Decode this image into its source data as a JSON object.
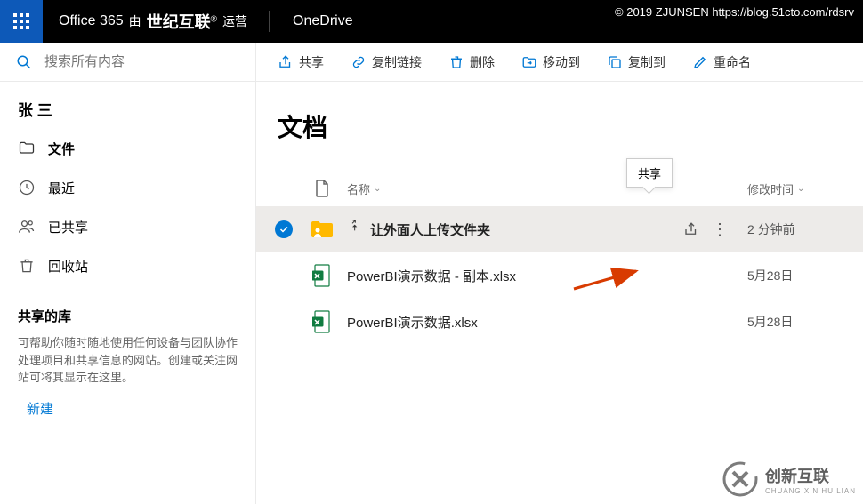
{
  "watermark": "© 2019 ZJUNSEN https://blog.51cto.com/rdsrv",
  "header": {
    "o365": "Office 365",
    "by": "由",
    "company": "世纪互联",
    "suffix": "运营",
    "app": "OneDrive"
  },
  "search": {
    "placeholder": "搜索所有内容"
  },
  "user": "张 三",
  "nav": {
    "files": "文件",
    "recent": "最近",
    "shared": "已共享",
    "recycle": "回收站"
  },
  "libs": {
    "title": "共享的库",
    "desc": "可帮助你随时随地使用任何设备与团队协作处理项目和共享信息的网站。创建或关注网站可将其显示在这里。",
    "new": "新建"
  },
  "cmd": {
    "share": "共享",
    "copylink": "复制链接",
    "delete": "删除",
    "moveto": "移动到",
    "copyto": "复制到",
    "rename": "重命名"
  },
  "page": {
    "title": "文档"
  },
  "cols": {
    "name": "名称",
    "modtime": "修改时间"
  },
  "tooltip": "共享",
  "rows": [
    {
      "name": "让外面人上传文件夹",
      "modified": "2 分钟前",
      "type": "folder",
      "selected": true
    },
    {
      "name": "PowerBI演示数据 - 副本.xlsx",
      "modified": "5月28日",
      "type": "xlsx",
      "selected": false
    },
    {
      "name": "PowerBI演示数据.xlsx",
      "modified": "5月28日",
      "type": "xlsx",
      "selected": false
    }
  ],
  "footer": {
    "brand": "创新互联",
    "sub": "CHUANG XIN HU LIAN"
  }
}
